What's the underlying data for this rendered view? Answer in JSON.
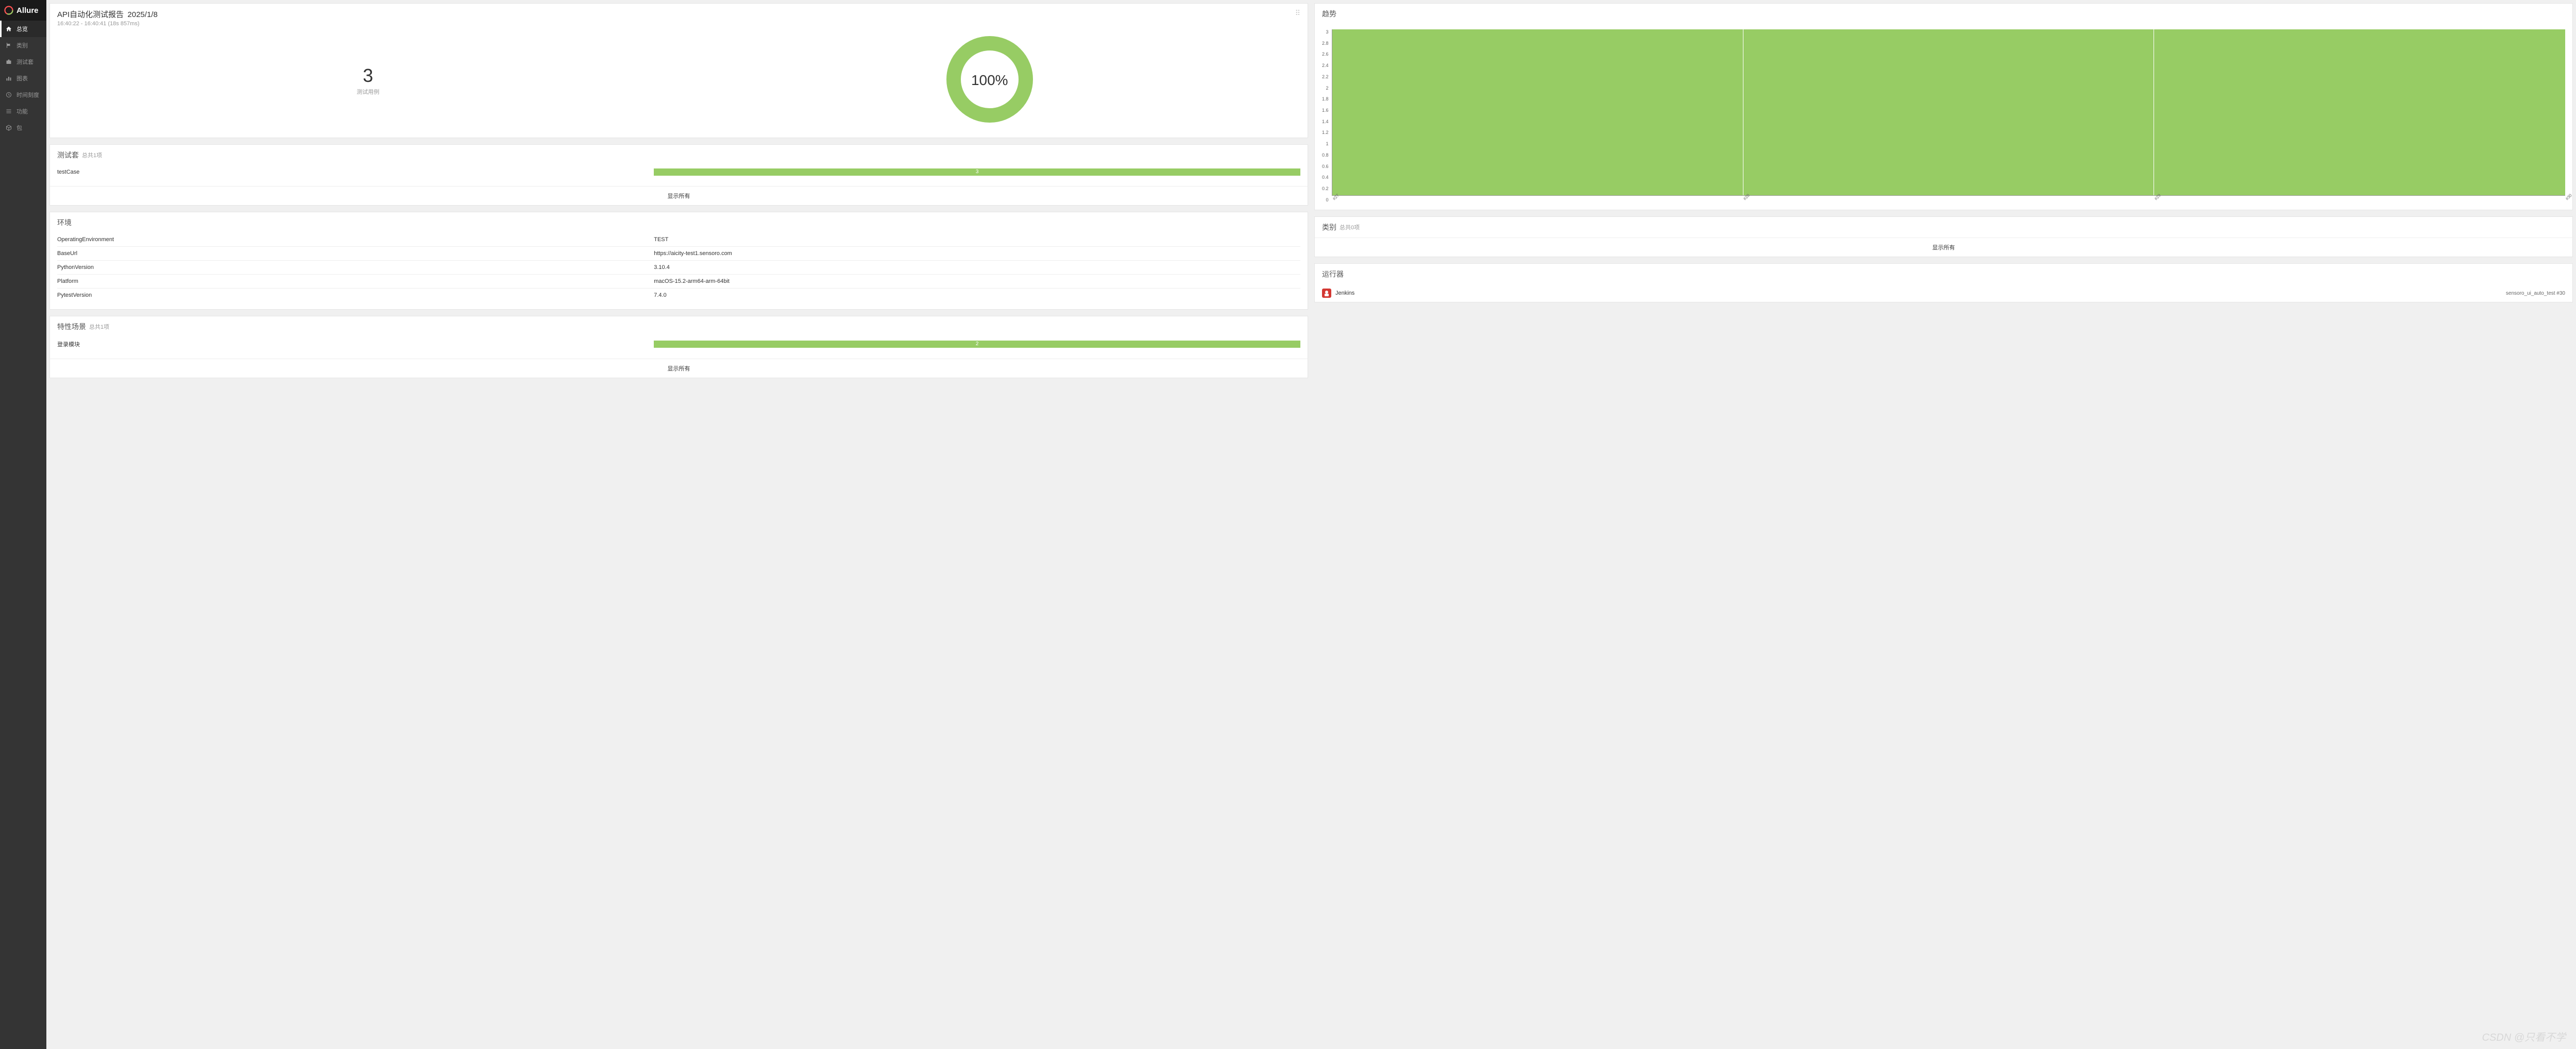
{
  "brand": "Allure",
  "nav": [
    {
      "icon": "home",
      "label": "总览",
      "active": true
    },
    {
      "icon": "flag",
      "label": "类别"
    },
    {
      "icon": "briefcase",
      "label": "测试套"
    },
    {
      "icon": "chart",
      "label": "图表"
    },
    {
      "icon": "clock",
      "label": "时间刻度"
    },
    {
      "icon": "list",
      "label": "功能"
    },
    {
      "icon": "package",
      "label": "包"
    }
  ],
  "summary": {
    "title": "API自动化测试报告",
    "date": "2025/1/8",
    "time_range": "16:40:22 - 16:40:41 (18s 857ms)",
    "test_count": "3",
    "test_count_label": "测试用例",
    "pass_pct": "100%"
  },
  "suites": {
    "title": "测试套",
    "subtitle": "总共1项",
    "rows": [
      {
        "name": "testCase",
        "value": "3",
        "pct": 100
      }
    ],
    "show_all": "显示所有"
  },
  "environment": {
    "title": "环境",
    "rows": [
      {
        "key": "OperatingEnvironment",
        "val": "TEST"
      },
      {
        "key": "BaseUrl",
        "val": "https://aicity-test1.sensoro.com"
      },
      {
        "key": "PythonVersion",
        "val": "3.10.4"
      },
      {
        "key": "Platform",
        "val": "macOS-15.2-arm64-arm-64bit"
      },
      {
        "key": "PytestVersion",
        "val": "7.4.0"
      }
    ]
  },
  "features": {
    "title": "特性场景",
    "subtitle": "总共1项",
    "rows": [
      {
        "name": "登录模块",
        "value": "2",
        "pct": 100
      }
    ],
    "show_all": "显示所有"
  },
  "trend": {
    "title": "趋势"
  },
  "categories": {
    "title": "类别",
    "subtitle": "总共0项",
    "show_all": "显示所有"
  },
  "executors": {
    "title": "运行器",
    "name": "Jenkins",
    "build": "sensoro_ui_auto_test #30"
  },
  "chart_data": {
    "type": "area",
    "title": "趋势",
    "xlabel": "",
    "ylabel": "",
    "ylim": [
      0,
      3
    ],
    "y_ticks": [
      "3",
      "2.8",
      "2.6",
      "2.4",
      "2.2",
      "2",
      "1.8",
      "1.6",
      "1.4",
      "1.2",
      "1",
      "0.8",
      "0.6",
      "0.4",
      "0.2",
      "0"
    ],
    "x_ticks": [
      "#27",
      "#28",
      "#29",
      "#30"
    ],
    "series": [
      {
        "name": "passed",
        "color": "#97cc64",
        "values": [
          3,
          3,
          3,
          3
        ]
      }
    ]
  },
  "watermark": "CSDN @只看不学"
}
